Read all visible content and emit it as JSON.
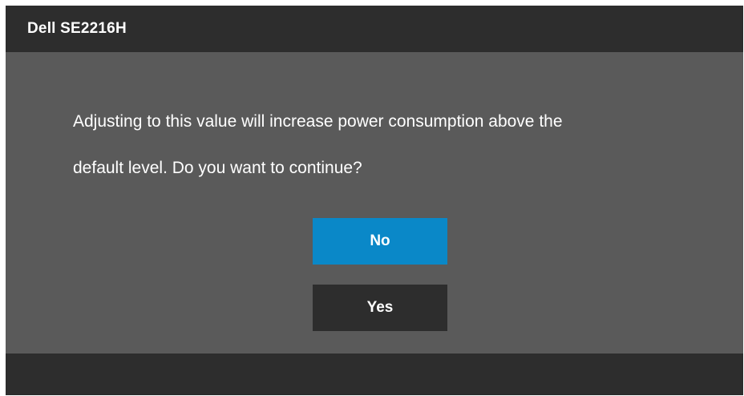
{
  "header": {
    "title": "Dell SE2216H"
  },
  "dialog": {
    "message_line_1": "Adjusting to this value will increase power consumption above the",
    "message_line_2": "default level. Do you want to continue?"
  },
  "buttons": {
    "no_label": "No",
    "yes_label": "Yes"
  },
  "colors": {
    "panel_background": "#5a5a5a",
    "bar_background": "#2d2d2d",
    "selected_button": "#0a88c8",
    "text": "#ffffff"
  }
}
